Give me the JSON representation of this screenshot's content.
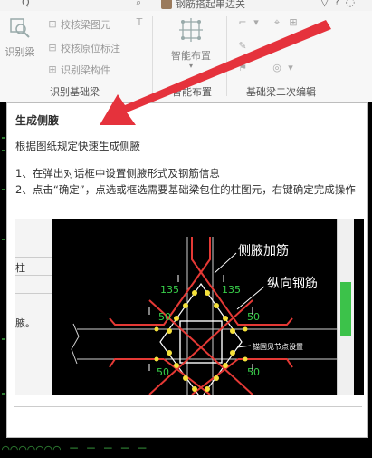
{
  "window": {
    "tab_partial": "Q",
    "title": "钢筋搭起串边关"
  },
  "ribbon": {
    "groups": [
      {
        "label": "识别基础梁",
        "big_button": "识别梁",
        "small_buttons": [
          "校核梁图元",
          "校核原位标注",
          "识别梁构件"
        ]
      },
      {
        "label": "智能布置",
        "big_button": "智能布置"
      },
      {
        "label": "基础梁二次编辑"
      }
    ]
  },
  "tooltip": {
    "title": "生成侧腋",
    "subtitle": "根据图纸规定快速生成侧腋",
    "step1": "1、在弹出对话框中设置侧腋形式及钢筋信息",
    "step2": "2、点击“确定”，点选或框选需要基础梁包住的柱图元，右键确定完成操作"
  },
  "illustration": {
    "dialog_text_1": "柱",
    "dialog_text_2": "腋。",
    "label_haunch_bar": "侧腋加筋",
    "label_long_bar": "纵向钢筋",
    "label_anchor": "锚固见节点设置",
    "dim_135": "135",
    "dim_50": "50"
  },
  "colors": {
    "accent_arrow": "#e5323c",
    "rebar_red": "#e53935",
    "rebar_dot": "#f5e13a",
    "dim_green": "#38d04a",
    "panel_bg": "#ffffff",
    "ribbon_bg": "#f7f7f7"
  }
}
